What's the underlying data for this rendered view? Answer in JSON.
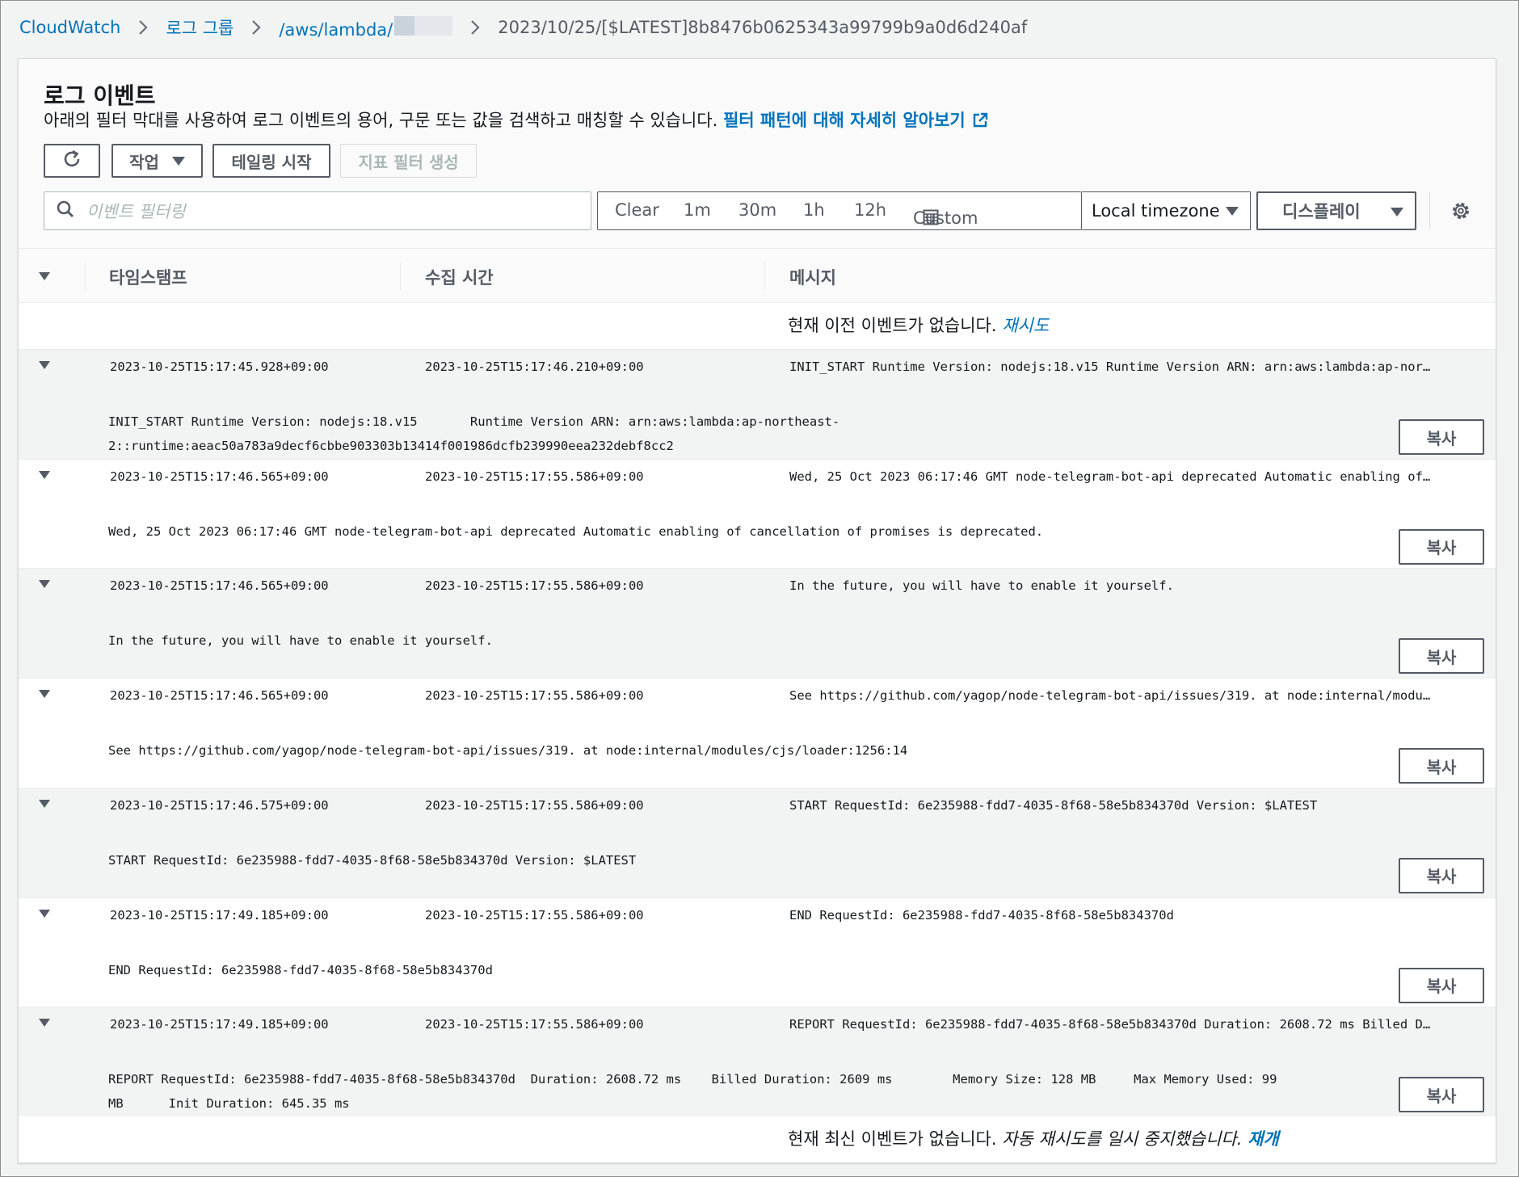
{
  "breadcrumb": {
    "items": [
      "CloudWatch",
      "로그 그룹",
      "/aws/lambda/"
    ],
    "current": "2023/10/25/[$LATEST]8b8476b0625343a99799b9a0d6d240af"
  },
  "panel": {
    "title": "로그 이벤트",
    "description": "아래의 필터 막대를 사용하여 로그 이벤트의 용어, 구문 또는 값을 검색하고 매칭할 수 있습니다.",
    "learn_more": "필터 패턴에 대해 자세히 알아보기"
  },
  "toolbar": {
    "actions": "작업",
    "tailing": "테일링 시작",
    "metric_filter": "지표 필터 생성"
  },
  "search": {
    "placeholder": "이벤트 필터링"
  },
  "time_range": {
    "options": [
      "Clear",
      "1m",
      "30m",
      "1h",
      "12h",
      "Custom"
    ],
    "timezone": "Local timezone",
    "display": "디스플레이"
  },
  "table": {
    "columns": [
      "타임스탬프",
      "수집 시간",
      "메시지"
    ],
    "top_notice": {
      "text": "현재 이전 이벤트가 없습니다.",
      "link": "재시도"
    },
    "bottom_notice": {
      "text": "현재 최신 이벤트가 없습니다.",
      "italic": "자동 재시도를 일시 중지했습니다.",
      "link": "재개"
    },
    "copy_label": "복사",
    "rows": [
      {
        "timestamp": "2023-10-25T15:17:45.928+09:00",
        "ingested": "2023-10-25T15:17:46.210+09:00",
        "message": "INIT_START Runtime Version: nodejs:18.v15 Runtime Version ARN: arn:aws:lambda:ap-nor…",
        "detail": "INIT_START Runtime Version: nodejs:18.v15       Runtime Version ARN: arn:aws:lambda:ap-northeast-\n2::runtime:aeac50a783a9decf6cbbe903303b13414f001986dcfb239990eea232debf8cc2"
      },
      {
        "timestamp": "2023-10-25T15:17:46.565+09:00",
        "ingested": "2023-10-25T15:17:55.586+09:00",
        "message": "Wed, 25 Oct 2023 06:17:46 GMT node-telegram-bot-api deprecated Automatic enabling of…",
        "detail": "Wed, 25 Oct 2023 06:17:46 GMT node-telegram-bot-api deprecated Automatic enabling of cancellation of promises is deprecated."
      },
      {
        "timestamp": "2023-10-25T15:17:46.565+09:00",
        "ingested": "2023-10-25T15:17:55.586+09:00",
        "message": "In the future, you will have to enable it yourself.",
        "detail": "In the future, you will have to enable it yourself."
      },
      {
        "timestamp": "2023-10-25T15:17:46.565+09:00",
        "ingested": "2023-10-25T15:17:55.586+09:00",
        "message": "See https://github.com/yagop/node-telegram-bot-api/issues/319. at node:internal/modu…",
        "detail": "See https://github.com/yagop/node-telegram-bot-api/issues/319. at node:internal/modules/cjs/loader:1256:14"
      },
      {
        "timestamp": "2023-10-25T15:17:46.575+09:00",
        "ingested": "2023-10-25T15:17:55.586+09:00",
        "message": "START RequestId: 6e235988-fdd7-4035-8f68-58e5b834370d Version: $LATEST",
        "detail": "START RequestId: 6e235988-fdd7-4035-8f68-58e5b834370d Version: $LATEST"
      },
      {
        "timestamp": "2023-10-25T15:17:49.185+09:00",
        "ingested": "2023-10-25T15:17:55.586+09:00",
        "message": "END RequestId: 6e235988-fdd7-4035-8f68-58e5b834370d",
        "detail": "END RequestId: 6e235988-fdd7-4035-8f68-58e5b834370d"
      },
      {
        "timestamp": "2023-10-25T15:17:49.185+09:00",
        "ingested": "2023-10-25T15:17:55.586+09:00",
        "message": "REPORT RequestId: 6e235988-fdd7-4035-8f68-58e5b834370d Duration: 2608.72 ms Billed D…",
        "detail": "REPORT RequestId: 6e235988-fdd7-4035-8f68-58e5b834370d  Duration: 2608.72 ms    Billed Duration: 2609 ms        Memory Size: 128 MB     Max Memory Used: 99\nMB      Init Duration: 645.35 ms"
      }
    ]
  }
}
